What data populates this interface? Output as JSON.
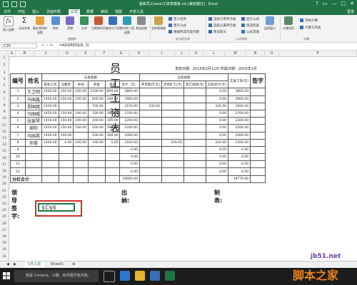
{
  "window": {
    "title": "最新员工excel工资表模板.xls [兼容模式] - Excel",
    "controls": [
      "?",
      "▭",
      "—",
      "□",
      "✕"
    ]
  },
  "ribbon_tabs": [
    "文件",
    "开始",
    "插入",
    "页面布局",
    "公式",
    "数据",
    "审阅",
    "视图",
    "开发工具"
  ],
  "active_tab": "公式",
  "user": "登录",
  "ribbon": {
    "big_buttons": [
      "插入函数",
      "自动求和",
      "最近使用的函数",
      "财务",
      "逻辑",
      "文本",
      "日期和时间",
      "查找与引用",
      "数学和三角函数",
      "其他函数",
      "名称管理器",
      "计算选项"
    ],
    "small_buttons": [
      "定义名称",
      "用于公式",
      "根据所选内容创建",
      "追踪引用单元格",
      "追踪从属单元格",
      "移去箭头",
      "显示公式",
      "错误检查",
      "公式求值",
      "监视窗口",
      "开始计算",
      "计算工作表"
    ],
    "groups": [
      "函数库",
      "定义的名称",
      "公式审核",
      "计算"
    ]
  },
  "formula_bar": {
    "name_box": "C20",
    "icons": "✕ ✓ fx",
    "formula": "=ADDRESS(6, 3)"
  },
  "columns": [
    "A",
    "B",
    "C",
    "D",
    "E",
    "F",
    "G",
    "H",
    "I",
    "J",
    "K",
    "L",
    "M",
    "N",
    "O",
    "P"
  ],
  "rows": [
    "1",
    "2",
    "3",
    "4",
    "5",
    "6",
    "7",
    "8",
    "9",
    "10",
    "11",
    "12",
    "13",
    "14",
    "15",
    "16",
    "17",
    "18",
    "19",
    "20",
    "21",
    "22",
    "23",
    "24",
    "25",
    "26",
    "27",
    "28",
    "29",
    "30",
    "31",
    "32"
  ],
  "sheet": {
    "title": "员工工资表",
    "dates": "发放日期：2015年2月12日  所属日期：2015年1月",
    "header": {
      "no": "编号",
      "name": "姓名",
      "payable_group": "应发金额",
      "deduct_group": "应扣金额",
      "actual": "实发工资(元)",
      "sign": "签字",
      "payable_cols": [
        "基本工资",
        "全勤奖",
        "补助",
        "奖金",
        "提成",
        "合计（元）"
      ],
      "deduct_cols": [
        "养老医疗(元)",
        "迟到矿工(元)",
        "其它扣款(元)",
        "应扣合计(元)"
      ]
    },
    "rows": [
      {
        "no": "1",
        "name": "王卫明",
        "v": [
          "1450.00",
          "150.00",
          "200.00",
          "1200.00",
          "800.00",
          "3800.00",
          "",
          "",
          "",
          "0.00",
          "3800.00",
          ""
        ]
      },
      {
        "no": "2",
        "name": "马国鑫",
        "v": [
          "1450.00",
          "150.00",
          "200.00",
          "800.00",
          "300.00",
          "2900.00",
          "",
          "",
          "",
          "0.00",
          "2900.00",
          ""
        ]
      },
      {
        "no": "3",
        "name": "郑国斌",
        "v": [
          "1450.00",
          "",
          "",
          "700.00",
          "",
          "2150.00",
          "330.00",
          "",
          "",
          "330.00",
          "1820.00",
          ""
        ]
      },
      {
        "no": "4",
        "name": "马国威",
        "v": [
          "1450.00",
          "150.00",
          "100.00",
          "700.00",
          "300.00",
          "2700.00",
          "",
          "",
          "",
          "0.00",
          "2700.00",
          ""
        ]
      },
      {
        "no": "5",
        "name": "张爱琴",
        "v": [
          "1450.00",
          "150.00",
          "100.00",
          "200.00",
          "300.00",
          "2200.00",
          "",
          "",
          "",
          "0.00",
          "2200.00",
          ""
        ]
      },
      {
        "no": "6",
        "name": "周阳",
        "v": [
          "1450.00",
          "150.00",
          "100.00",
          "200.00",
          "300.00",
          "2200.00",
          "",
          "",
          "",
          "0.00",
          "2200.00",
          ""
        ]
      },
      {
        "no": "7",
        "name": "马国昌",
        "v": [
          "1450.00",
          "150.00",
          "",
          "100.00",
          "300.00",
          "2000.00",
          "",
          "",
          "",
          "0.00",
          "2000.00",
          ""
        ]
      },
      {
        "no": "8",
        "name": "邓睿",
        "v": [
          "1450.00",
          "0.00",
          "100.00",
          "100.00",
          "0.00",
          "1650.00",
          "",
          "200.00",
          "",
          "200.00",
          "1450.00",
          ""
        ]
      },
      {
        "no": "9",
        "name": "",
        "v": [
          "",
          "",
          "",
          "",
          "",
          "0.00",
          "",
          "",
          "",
          "0.00",
          "0.00",
          ""
        ]
      },
      {
        "no": "10",
        "name": "",
        "v": [
          "",
          "",
          "",
          "",
          "",
          "0.00",
          "",
          "",
          "",
          "0.00",
          "0.00",
          ""
        ]
      },
      {
        "no": "11",
        "name": "",
        "v": [
          "",
          "",
          "",
          "",
          "",
          "0.00",
          "",
          "",
          "",
          "0.00",
          "0.00",
          ""
        ]
      },
      {
        "no": "12",
        "name": "",
        "v": [
          "",
          "",
          "",
          "",
          "",
          "0.00",
          "",
          "",
          "",
          "0.00",
          "0.00",
          ""
        ]
      }
    ],
    "subtotal": {
      "label": "分栏合计",
      "total_pay": "19000.00",
      "total_actual": "18770.00"
    },
    "signatures": {
      "leader": "领导签字:",
      "cashier": "出纳:",
      "preparer": "制表:"
    },
    "selected_cell_value": "$C$6"
  },
  "sheet_tabs": [
    "5月工资",
    "Sheet3"
  ],
  "active_sheet": "5月工资",
  "taskbar": {
    "search_placeholder": "我是 Cortana，小娜。有问题尽管问我。"
  },
  "watermark": {
    "site": "jb51.net",
    "name": "脚本之家"
  },
  "colors": {
    "excel_green": "#217346",
    "highlight_red": "#d0302b",
    "watermark_purple": "#6b3d9a",
    "watermark_orange": "#e8821a"
  }
}
